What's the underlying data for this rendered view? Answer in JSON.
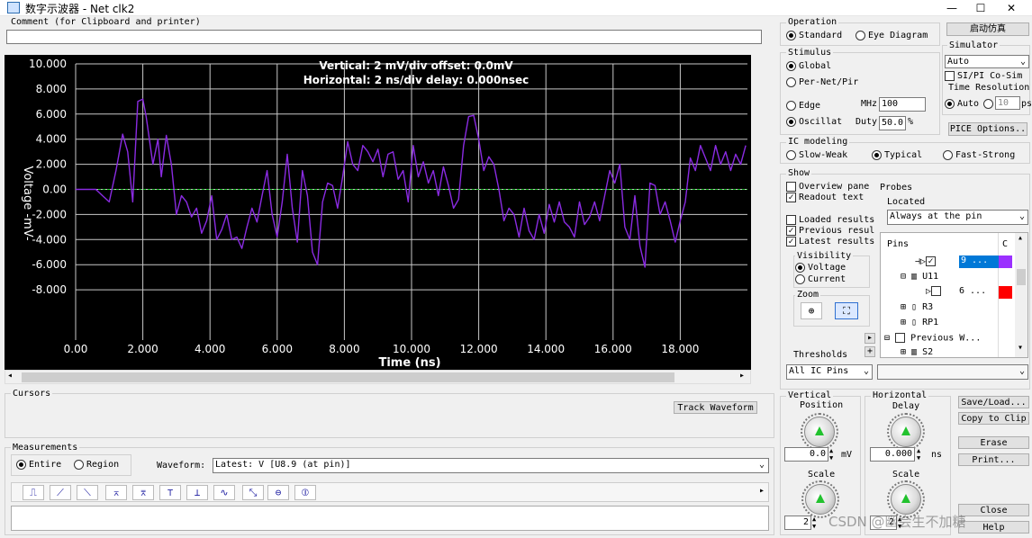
{
  "window": {
    "title": "数字示波器 - Net clk2",
    "minimize": "—",
    "maximize": "☐",
    "close": "✕"
  },
  "comment": {
    "label": "Comment (for Clipboard and printer)",
    "value": ""
  },
  "plot": {
    "vertical_info": "Vertical: 2 mV/div  offset: 0.0mV",
    "horizontal_info": "Horizontal: 2 ns/div  delay: 0.000nsec",
    "y_axis_label": "Voltage -mV-",
    "x_axis_label": "Time (ns)",
    "y_ticks": [
      "10.000",
      "8.000",
      "6.000",
      "4.000",
      "2.000",
      "0.00",
      "-2.000",
      "-4.000",
      "-6.000",
      "-8.000"
    ],
    "x_ticks": [
      "0.00",
      "2.000",
      "4.000",
      "6.000",
      "8.000",
      "10.000",
      "12.000",
      "14.000",
      "16.000",
      "18.000"
    ],
    "waveform_color": "#8a2be2",
    "baseline_color": "#22c22e"
  },
  "chart_data": {
    "type": "line",
    "xlabel": "Time (ns)",
    "ylabel": "Voltage -mV-",
    "xlim": [
      0,
      20
    ],
    "ylim": [
      -10,
      10
    ],
    "grid": true,
    "series": [
      {
        "values_x": [
          0,
          0.6,
          0.8,
          1.0,
          1.2,
          1.4,
          1.55,
          1.7,
          1.85,
          2.0,
          2.1,
          2.3,
          2.45,
          2.55,
          2.7,
          2.85,
          3.0,
          3.15,
          3.3,
          3.45,
          3.6,
          3.75,
          3.9,
          4.05,
          4.2,
          4.35,
          4.5,
          4.65,
          4.8,
          4.95,
          5.1,
          5.25,
          5.4,
          5.55,
          5.7,
          5.85,
          6.0,
          6.15,
          6.3,
          6.45,
          6.6,
          6.75,
          6.9,
          7.05,
          7.2,
          7.35,
          7.5,
          7.65,
          7.8,
          7.95,
          8.1,
          8.25,
          8.4,
          8.55,
          8.7,
          8.85,
          9.0,
          9.15,
          9.3,
          9.45,
          9.6,
          9.75,
          9.9,
          10.05,
          10.2,
          10.35,
          10.5,
          10.65,
          10.8,
          10.95,
          11.1,
          11.25,
          11.4,
          11.55,
          11.7,
          11.85,
          12.0,
          12.15,
          12.3,
          12.45,
          12.6,
          12.75,
          12.9,
          13.05,
          13.2,
          13.35,
          13.5,
          13.65,
          13.8,
          13.95,
          14.1,
          14.25,
          14.4,
          14.55,
          14.7,
          14.85,
          15.0,
          15.15,
          15.3,
          15.45,
          15.6,
          15.75,
          15.9,
          16.05,
          16.2,
          16.35,
          16.5,
          16.65,
          16.8,
          16.95,
          17.1,
          17.25,
          17.4,
          17.55,
          17.7,
          17.85,
          18.0,
          18.15,
          18.3,
          18.45,
          18.6,
          18.75,
          18.9,
          19.05,
          19.2,
          19.35,
          19.5,
          19.65,
          19.8,
          19.95
        ],
        "values_y": [
          0,
          0,
          -0.5,
          -1.0,
          1.5,
          4.4,
          3.0,
          -1.0,
          7.0,
          7.2,
          5.8,
          2.0,
          4.0,
          1.0,
          4.3,
          2.0,
          -2.0,
          -0.5,
          -1.0,
          -2.2,
          -1.5,
          -3.5,
          -2.5,
          -0.5,
          -4.0,
          -3.2,
          -2.0,
          -4.0,
          -3.8,
          -4.7,
          -3.0,
          -1.5,
          -2.6,
          -0.5,
          1.5,
          -2.0,
          -3.8,
          -1.0,
          2.8,
          -1.5,
          -4.2,
          1.5,
          -0.5,
          -5.0,
          -6.0,
          -1.0,
          0.5,
          0.3,
          -1.5,
          1.0,
          3.8,
          2.0,
          1.5,
          3.5,
          3.0,
          2.2,
          3.2,
          1.0,
          2.8,
          3.0,
          0.8,
          1.5,
          -1.0,
          3.5,
          1.0,
          2.2,
          0.5,
          1.5,
          -0.5,
          1.8,
          0.3,
          -1.5,
          -0.8,
          3.5,
          5.8,
          5.9,
          4.0,
          1.5,
          2.6,
          2.0,
          0.0,
          -2.5,
          -1.5,
          -2.0,
          -3.8,
          -1.5,
          -3.3,
          -4.0,
          -2.0,
          -3.5,
          -1.2,
          -2.6,
          -1.0,
          -2.6,
          -3.0,
          -3.8,
          -1.0,
          -2.8,
          -2.2,
          -1.0,
          -2.5,
          -0.5,
          1.5,
          0.5,
          2.0,
          -3.0,
          -4.0,
          -0.5,
          -4.5,
          -6.2,
          0.5,
          0.3,
          -2.0,
          -1.0,
          -2.5,
          -4.2,
          -2.5,
          -1.0,
          2.5,
          1.5,
          3.5,
          2.5,
          1.5,
          3.5,
          2.0,
          3.0,
          1.5,
          2.8,
          2.0,
          3.5,
          4.1,
          2.8
        ]
      }
    ]
  },
  "operation": {
    "title": "Operation",
    "standard": "Standard",
    "eye": "Eye Diagram"
  },
  "stimulus": {
    "title": "Stimulus",
    "global": "Global",
    "per_net": "Per-Net/Pir",
    "edge": "Edge",
    "oscillat": "Oscillat",
    "mhz_label": "MHz",
    "mhz_value": "100",
    "duty_label": "Duty",
    "duty_value": "50.0",
    "duty_unit": "%"
  },
  "start_button": "启动仿真",
  "simulator": {
    "title": "Simulator",
    "engine": "Auto",
    "cosim": "SI/PI Co-Sim",
    "time_res": "Time Resolution",
    "auto": "Auto",
    "value": "10",
    "unit": "ps",
    "pice_button": "PICE Options.."
  },
  "ic_modeling": {
    "title": "IC modeling",
    "slow": "Slow-Weak",
    "typical": "Typical",
    "fast": "Fast-Strong"
  },
  "show": {
    "title": "Show",
    "overview": "Overview pane",
    "readout": "Readout text",
    "loaded": "Loaded results",
    "previous": "Previous resul",
    "latest": "Latest results"
  },
  "probes": {
    "title": "Probes",
    "located_label": "Located",
    "located_value": "Always at the pin"
  },
  "visibility": {
    "title": "Visibility",
    "voltage": "Voltage",
    "current": "Current"
  },
  "zoom": {
    "title": "Zoom"
  },
  "pins_tree": {
    "header_pins": "Pins",
    "header_c": "C",
    "items": [
      {
        "label": "",
        "value": "9 ...",
        "color": "#9b30ff"
      },
      {
        "label": "U11",
        "value": "",
        "color": ""
      },
      {
        "label": "",
        "value": "6 ...",
        "color": "#ff0000"
      },
      {
        "label": "R3",
        "value": "",
        "color": ""
      },
      {
        "label": "RP1",
        "value": "",
        "color": ""
      },
      {
        "label": "Previous W...",
        "value": "",
        "color": ""
      },
      {
        "label": "S2",
        "value": "",
        "color": ""
      }
    ]
  },
  "thresholds": {
    "label": "Thresholds",
    "value": "All IC Pins"
  },
  "cursors": {
    "title": "Cursors",
    "track_button": "Track Waveform"
  },
  "measurements": {
    "title": "Measurements",
    "entire": "Entire",
    "region": "Region",
    "waveform_label": "Waveform:",
    "waveform_value": "Latest: V [U8.9 (at pin)]"
  },
  "vertical": {
    "title": "Vertical",
    "position": "Position",
    "value": "0.0",
    "unit": "mV",
    "scale": "Scale",
    "scale_value": "2"
  },
  "horizontal": {
    "title": "Horizontal",
    "delay": "Delay",
    "value": "0.000",
    "unit": "ns",
    "scale": "Scale",
    "scale_value": "2"
  },
  "right_buttons": {
    "save": "Save/Load...",
    "copy": "Copy to Clip",
    "erase": "Erase",
    "print": "Print...",
    "close": "Close",
    "help": "Help"
  },
  "watermark": "CSDN @幽会生不加糖"
}
